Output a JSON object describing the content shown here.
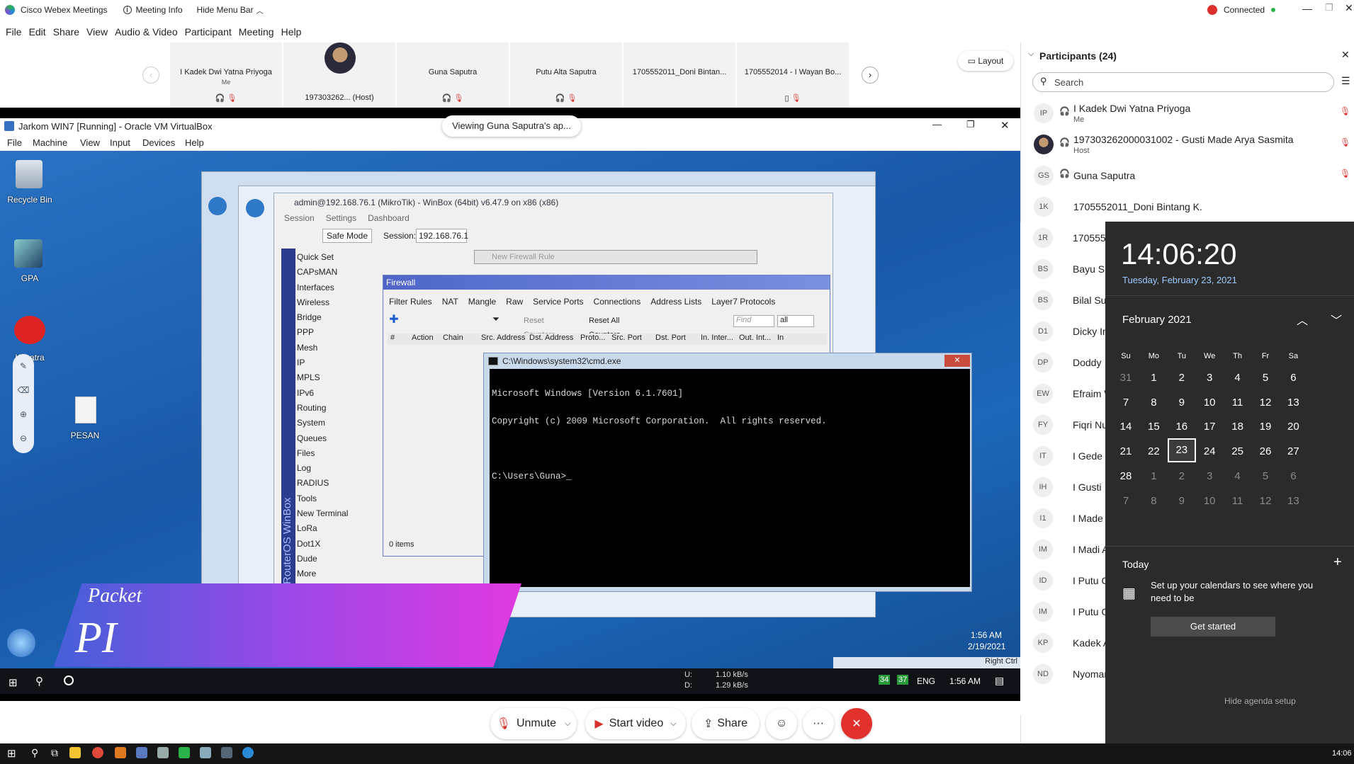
{
  "app": {
    "title": "Cisco Webex Meetings",
    "meeting_info": "Meeting Info",
    "hide_menu": "Hide Menu Bar",
    "status": "Connected"
  },
  "menu": [
    "File",
    "Edit",
    "Share",
    "View",
    "Audio & Video",
    "Participant",
    "Meeting",
    "Help"
  ],
  "layout_label": "Layout",
  "thumbs": [
    {
      "name": "I Kadek Dwi Yatna Priyoga",
      "sub": "Me"
    },
    {
      "name": "197303262... (Host)",
      "sub": ""
    },
    {
      "name": "Guna Saputra",
      "sub": ""
    },
    {
      "name": "Putu Alta Saputra",
      "sub": ""
    },
    {
      "name": "1705552011_Doni Bintan...",
      "sub": ""
    },
    {
      "name": "1705552014 - I Wayan Bo...",
      "sub": ""
    }
  ],
  "viewing_text": "Viewing Guna Saputra's ap...",
  "shared": {
    "vbox_title": "Jarkom WIN7 [Running] - Oracle VM VirtualBox",
    "vbox_menu": [
      "File",
      "Machine",
      "View",
      "Input",
      "Devices",
      "Help"
    ],
    "desktop_icons": [
      "Recycle Bin",
      "GPA",
      "Kusatra",
      "PESAN"
    ],
    "winbox_title": "admin@192.168.76.1 (MikroTik) - WinBox (64bit) v6.47.9 on x86 (x86)",
    "winbox_menu": [
      "Session",
      "Settings",
      "Dashboard"
    ],
    "safe_mode": "Safe Mode",
    "session_label": "Session:",
    "session_value": "192.168.76.1",
    "winbox_side": [
      "Quick Set",
      "CAPsMAN",
      "Interfaces",
      "Wireless",
      "Bridge",
      "PPP",
      "Mesh",
      "IP",
      "MPLS",
      "IPv6",
      "Routing",
      "System",
      "Queues",
      "Files",
      "Log",
      "RADIUS",
      "Tools",
      "New Terminal",
      "LoRa",
      "Dot1X",
      "Dude",
      "More"
    ],
    "routeros_label": "RouterOS WinBox",
    "new_rule": "New Firewall Rule",
    "fw_title": "Firewall",
    "fw_tabs": [
      "Filter Rules",
      "NAT",
      "Mangle",
      "Raw",
      "Service Ports",
      "Connections",
      "Address Lists",
      "Layer7 Protocols"
    ],
    "fw_reset": "Reset Counters",
    "fw_reset_all": "Reset All Counters",
    "fw_find": "Find",
    "fw_all": "all",
    "fw_cols": [
      "#",
      "Action",
      "Chain",
      "Src. Address",
      "Dst. Address",
      "Proto...",
      "Src. Port",
      "Dst. Port",
      "In. Inter...",
      "Out. Int...",
      "In"
    ],
    "fw_items": "0 items",
    "cmd_title": "C:\\Windows\\system32\\cmd.exe",
    "cmd_lines": [
      "Microsoft Windows [Version 6.1.7601]",
      "Copyright (c) 2009 Microsoft Corporation.  All rights reserved.",
      "",
      "C:\\Users\\Guna>_"
    ],
    "banner_top": "Packet",
    "banner_big": "PI",
    "w7_time": "1:56 AM",
    "w7_date": "2/19/2021",
    "right_ctrl": "Right Ctrl",
    "net_up": "1.10 kB/s",
    "net_down": "1.29 kB/s",
    "net_u_label": "U:",
    "net_d_label": "D:",
    "host_lang": "ENG",
    "host_time": "1:56 AM",
    "host_badges": [
      "34",
      "37"
    ]
  },
  "controls": {
    "unmute": "Unmute",
    "start_video": "Start video",
    "share": "Share",
    "more": "···"
  },
  "panel": {
    "title": "Participants (24)",
    "search_placeholder": "Search",
    "rows": [
      {
        "initials": "IP",
        "name": "I Kadek Dwi Yatna Priyoga",
        "sub": "Me"
      },
      {
        "initials": "",
        "name": "197303262000031002 - Gusti Made Arya Sasmita",
        "sub": "Host"
      },
      {
        "initials": "GS",
        "name": "Guna Saputra",
        "sub": ""
      },
      {
        "initials": "1K",
        "name": "1705552011_Doni Bintang K.",
        "sub": ""
      },
      {
        "initials": "1R",
        "name": "170555",
        "sub": ""
      },
      {
        "initials": "BS",
        "name": "Bayu Su",
        "sub": ""
      },
      {
        "initials": "BS",
        "name": "Bilal Sur",
        "sub": ""
      },
      {
        "initials": "D1",
        "name": "Dicky In",
        "sub": ""
      },
      {
        "initials": "DP",
        "name": "Doddy",
        "sub": ""
      },
      {
        "initials": "EW",
        "name": "Efraim W",
        "sub": ""
      },
      {
        "initials": "FY",
        "name": "Fiqri Nu",
        "sub": ""
      },
      {
        "initials": "IT",
        "name": "I Gede",
        "sub": ""
      },
      {
        "initials": "IH",
        "name": "I Gusti",
        "sub": ""
      },
      {
        "initials": "I1",
        "name": "I Made",
        "sub": ""
      },
      {
        "initials": "IM",
        "name": "I Madi A",
        "sub": ""
      },
      {
        "initials": "ID",
        "name": "I Putu C",
        "sub": ""
      },
      {
        "initials": "IM",
        "name": "I Putu G",
        "sub": ""
      },
      {
        "initials": "KP",
        "name": "Kadek A",
        "sub": ""
      },
      {
        "initials": "ND",
        "name": "Nyoman",
        "sub": ""
      }
    ]
  },
  "calendar": {
    "time": "14:06:20",
    "date": "Tuesday, February 23, 2021",
    "month": "February 2021",
    "weekdays": [
      "Su",
      "Mo",
      "Tu",
      "We",
      "Th",
      "Fr",
      "Sa"
    ],
    "weeks": [
      [
        "31",
        "1",
        "2",
        "3",
        "4",
        "5",
        "6"
      ],
      [
        "7",
        "8",
        "9",
        "10",
        "11",
        "12",
        "13"
      ],
      [
        "14",
        "15",
        "16",
        "17",
        "18",
        "19",
        "20"
      ],
      [
        "21",
        "22",
        "23",
        "24",
        "25",
        "26",
        "27"
      ],
      [
        "28",
        "1",
        "2",
        "3",
        "4",
        "5",
        "6"
      ],
      [
        "7",
        "8",
        "9",
        "10",
        "11",
        "12",
        "13"
      ]
    ],
    "today_label": "Today",
    "agenda_text": "Set up your calendars to see where you need to be",
    "get_started": "Get started",
    "hide_agenda": "Hide agenda setup"
  },
  "taskbar_time": "14:06",
  "colors": {
    "accent_red": "#d9302c",
    "connected_green": "#2bb34b",
    "calendar_bg": "#2b2b2b",
    "desktop_blue": "#1d66b8"
  }
}
